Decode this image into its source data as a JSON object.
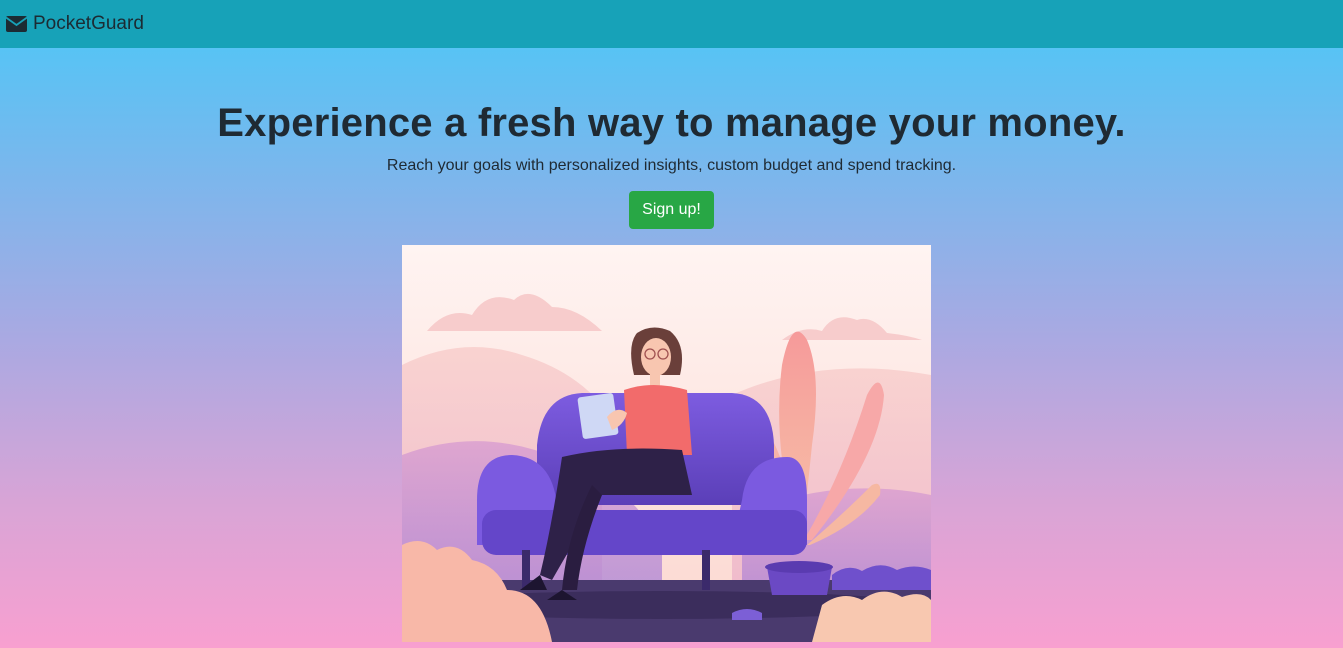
{
  "navbar": {
    "brand_label": "PocketGuard",
    "brand_icon": "envelope-icon"
  },
  "hero": {
    "headline": "Experience a fresh way to manage your money.",
    "subtitle": "Reach your goals with personalized insights, custom budget and spend tracking.",
    "cta_label": "Sign up!"
  },
  "illustration": {
    "subject": "woman-on-sofa-with-tablet"
  },
  "colors": {
    "navbar": "#17a2b8",
    "gradient_top": "#4ac8f8",
    "gradient_bottom": "#f8a0d0",
    "cta": "#28a745",
    "text": "#1f2a33"
  }
}
